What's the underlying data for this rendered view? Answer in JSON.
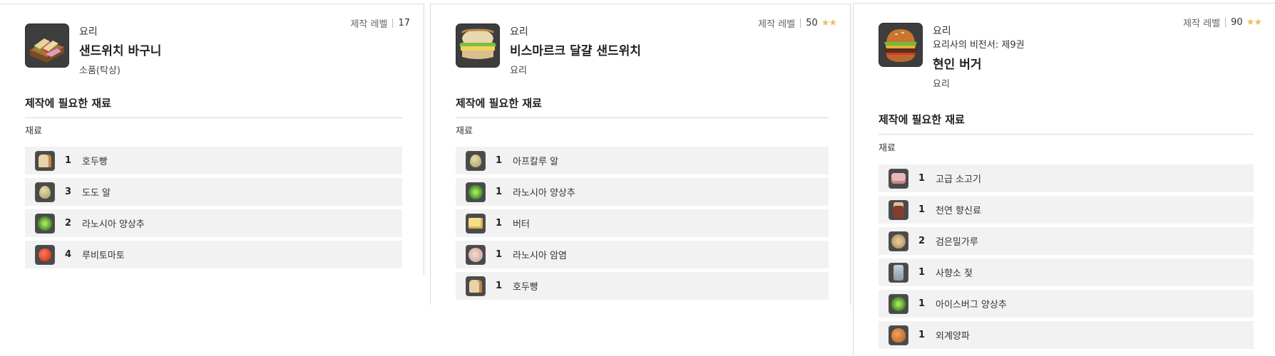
{
  "level_label": "제작 레벨",
  "section_title": "제작에 필요한 재료",
  "materials_label": "재료",
  "recipes": [
    {
      "category": "요리",
      "title": "샌드위치 바구니",
      "subtitle": "소품(탁상)",
      "level": "17",
      "stars": "",
      "icon": "sandwich-basket-icon",
      "materials": [
        {
          "qty": "1",
          "name": "호두빵",
          "icon": "bread-icon"
        },
        {
          "qty": "3",
          "name": "도도 알",
          "icon": "egg-icon"
        },
        {
          "qty": "2",
          "name": "라노시아 양상추",
          "icon": "lettuce-icon"
        },
        {
          "qty": "4",
          "name": "루비토마토",
          "icon": "tomato-icon"
        }
      ]
    },
    {
      "category": "요리",
      "title": "비스마르크 달걀 샌드위치",
      "subtitle": "요리",
      "level": "50",
      "stars": "★★",
      "icon": "egg-sandwich-icon",
      "materials": [
        {
          "qty": "1",
          "name": "아프칼루 알",
          "icon": "egg-icon"
        },
        {
          "qty": "1",
          "name": "라노시아 양상추",
          "icon": "lettuce-icon"
        },
        {
          "qty": "1",
          "name": "버터",
          "icon": "butter-icon"
        },
        {
          "qty": "1",
          "name": "라노시아 암염",
          "icon": "rock-salt-icon"
        },
        {
          "qty": "1",
          "name": "호두빵",
          "icon": "bread-icon"
        }
      ]
    },
    {
      "category": "요리",
      "book": "요리사의 비전서: 제9권",
      "title": "현인 버거",
      "subtitle": "요리",
      "level": "90",
      "stars": "★★",
      "icon": "burger-icon",
      "materials": [
        {
          "qty": "1",
          "name": "고급 소고기",
          "icon": "beef-icon"
        },
        {
          "qty": "1",
          "name": "천연 향신료",
          "icon": "spice-jar-icon"
        },
        {
          "qty": "2",
          "name": "검은밀가루",
          "icon": "flour-icon"
        },
        {
          "qty": "1",
          "name": "사향소 젖",
          "icon": "milk-bottle-icon"
        },
        {
          "qty": "1",
          "name": "아이스버그 양상추",
          "icon": "lettuce-icon"
        },
        {
          "qty": "1",
          "name": "외계양파",
          "icon": "onion-icon"
        }
      ]
    }
  ]
}
